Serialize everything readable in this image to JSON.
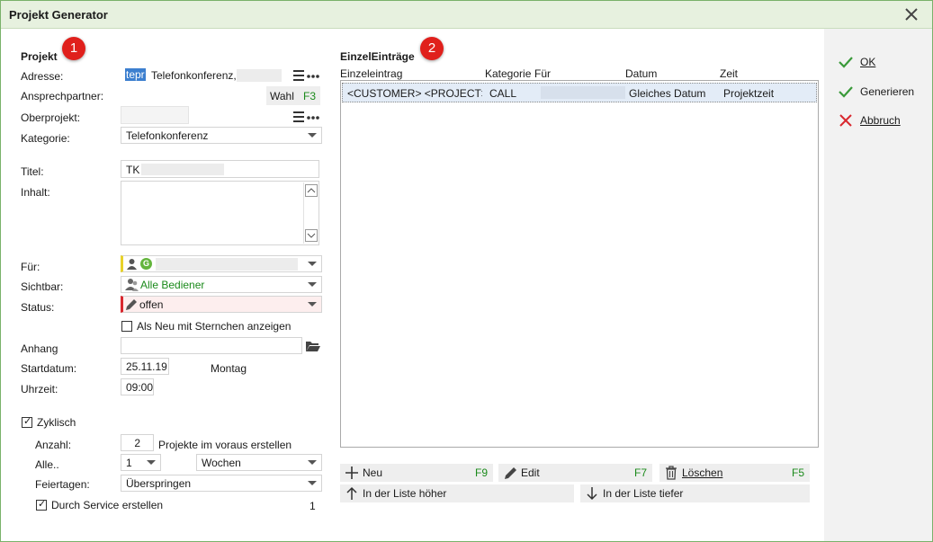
{
  "window": {
    "title": "Projekt Generator"
  },
  "badges": {
    "one": "1",
    "two": "2"
  },
  "actions": {
    "ok": "OK",
    "generate": "Generieren",
    "cancel": "Abbruch"
  },
  "project": {
    "section_title": "Projekt",
    "address_label": "Adresse:",
    "address_selected": "tepr",
    "address_value": "Telefonkonferenz,",
    "contact_label": "Ansprechpartner:",
    "contact_button": "Wahl",
    "contact_key": "F3",
    "parent_label": "Oberprojekt:",
    "category_label": "Kategorie:",
    "category_value": "Telefonkonferenz",
    "title_label": "Titel:",
    "title_value": "TK",
    "content_label": "Inhalt:",
    "for_label": "Für:",
    "for_group": "G",
    "visible_label": "Sichtbar:",
    "visible_value": "Alle Bediener",
    "status_label": "Status:",
    "status_value": "offen",
    "new_star_label": "Als Neu mit Sternchen anzeigen",
    "attachment_label": "Anhang",
    "start_label": "Startdatum:",
    "start_value": "25.11.19",
    "weekday": "Montag",
    "time_label": "Uhrzeit:",
    "time_value": "09:00",
    "cyclic_label": "Zyklisch",
    "count_label": "Anzahl:",
    "count_value": "2",
    "count_suffix": "Projekte im voraus erstellen",
    "every_label": "Alle..",
    "every_value": "1",
    "every_unit": "Wochen",
    "holidays_label": "Feiertagen:",
    "holidays_value": "Überspringen",
    "service_label": "Durch Service erstellen",
    "service_value": "1"
  },
  "entries": {
    "section_title": "EinzelEinträge",
    "columns": {
      "entry": "Einzeleintrag",
      "category": "Kategorie",
      "for": "Für",
      "date": "Datum",
      "time": "Zeit"
    },
    "rows": [
      {
        "entry": "<CUSTOMER> <PROJECT> //<L",
        "category": "CALL",
        "date": "Gleiches Datum",
        "time": "Projektzeit"
      }
    ],
    "buttons": {
      "new": "Neu",
      "new_key": "F9",
      "edit": "Edit",
      "edit_key": "F7",
      "delete": "Löschen",
      "delete_key": "F5",
      "up": "In der Liste höher",
      "down": "In der Liste tiefer"
    }
  },
  "colors": {
    "accent_green": "#1b8a1b",
    "badge_red": "#e0201c",
    "title_bg": "#e7f1df"
  }
}
